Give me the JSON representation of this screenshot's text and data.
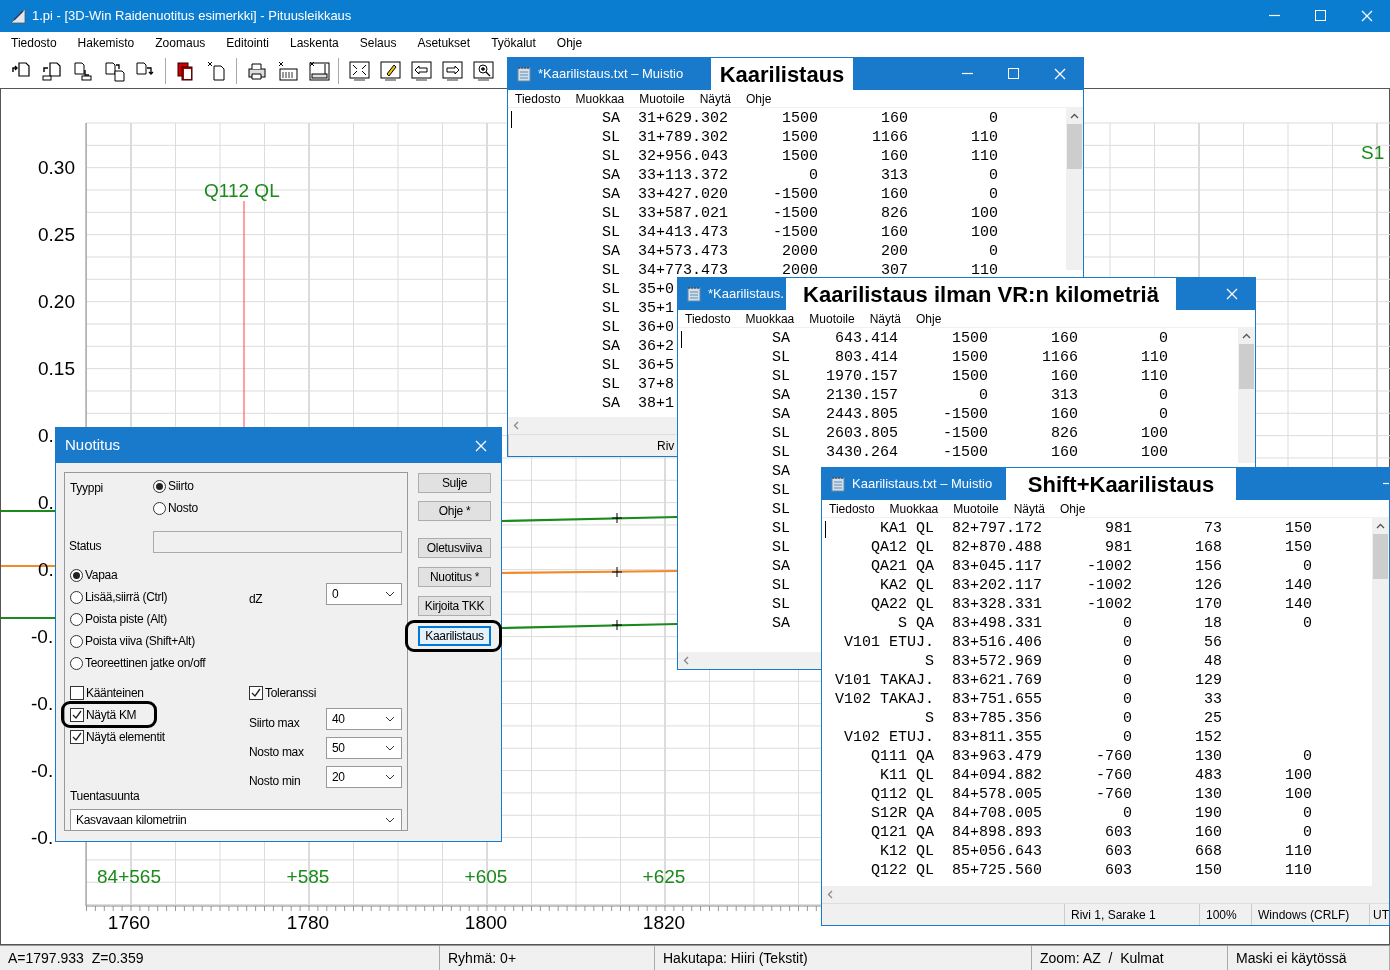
{
  "window": {
    "title": "1.pi - [3D-Win Raidenuotitus esimerkki] - Pituusleikkaus"
  },
  "menu": [
    "Tiedosto",
    "Hakemisto",
    "Zoomaus",
    "Editointi",
    "Laskenta",
    "Selaus",
    "Asetukset",
    "Työkalut",
    "Ohje"
  ],
  "profile": {
    "y_labels": [
      "0.30",
      "0.25",
      "0.20",
      "0.15",
      "0.",
      "0.",
      "0.",
      "-0.",
      "-0.",
      "-0.",
      "-0."
    ],
    "km_labels": [
      "84+565",
      "+585",
      "+605",
      "+625"
    ],
    "x_labels": [
      "1760",
      "1780",
      "1800",
      "1820"
    ],
    "marker_label": "Q112 QL",
    "edge_label": "S1"
  },
  "notepads": [
    {
      "title": "*Kaarilistaus.txt – Muistio",
      "caption": "Kaarilistaus",
      "menu": [
        "Tiedosto",
        "Muokkaa",
        "Muotoile",
        "Näytä",
        "Ohje"
      ],
      "rows": [
        [
          "SA",
          "31+629.302",
          "1500",
          "160",
          "0"
        ],
        [
          "SL",
          "31+789.302",
          "1500",
          "1166",
          "110"
        ],
        [
          "SL",
          "32+956.043",
          "1500",
          "160",
          "110"
        ],
        [
          "SA",
          "33+113.372",
          "0",
          "313",
          "0"
        ],
        [
          "SA",
          "33+427.020",
          "-1500",
          "160",
          "0"
        ],
        [
          "SL",
          "33+587.021",
          "-1500",
          "826",
          "100"
        ],
        [
          "SL",
          "34+413.473",
          "-1500",
          "160",
          "100"
        ],
        [
          "SA",
          "34+573.473",
          "2000",
          "200",
          "0"
        ],
        [
          "SL",
          "34+773.473",
          "2000",
          "307",
          "110"
        ],
        [
          "SL",
          "35+0"
        ],
        [
          "SL",
          "35+1"
        ],
        [
          "SL",
          "36+0"
        ],
        [
          "SA",
          "36+2"
        ],
        [
          "SL",
          "36+5"
        ],
        [
          "SL",
          "37+8"
        ],
        [
          "SA",
          "38+1"
        ]
      ],
      "status": [
        "Riv"
      ]
    },
    {
      "title": "*Kaarilistaus.",
      "caption": "Kaarilistaus ilman VR:n kilometriä",
      "menu": [
        "Tiedosto",
        "Muokkaa",
        "Muotoile",
        "Näytä",
        "Ohje"
      ],
      "rows": [
        [
          "SA",
          "643.414",
          "1500",
          "160",
          "0"
        ],
        [
          "SL",
          "803.414",
          "1500",
          "1166",
          "110"
        ],
        [
          "SL",
          "1970.157",
          "1500",
          "160",
          "110"
        ],
        [
          "SA",
          "2130.157",
          "0",
          "313",
          "0"
        ],
        [
          "SA",
          "2443.805",
          "-1500",
          "160",
          "0"
        ],
        [
          "SL",
          "2603.805",
          "-1500",
          "826",
          "100"
        ],
        [
          "SL",
          "3430.264",
          "-1500",
          "160",
          "100"
        ],
        [
          "SA"
        ],
        [
          "SL"
        ],
        [
          "SL"
        ],
        [
          "SL"
        ],
        [
          "SL"
        ],
        [
          "SA"
        ],
        [
          "SL"
        ],
        [
          "SL"
        ],
        [
          "SA"
        ]
      ]
    },
    {
      "title": "Kaarilistaus.txt – Muistio",
      "caption": "Shift+Kaarilistaus",
      "menu": [
        "Tiedosto",
        "Muokkaa",
        "Muotoile",
        "Näytä",
        "Ohje"
      ],
      "rows": [
        [
          "KA1 QL",
          "82+797.172",
          "981",
          "73",
          "150"
        ],
        [
          "QA12 QL",
          "82+870.488",
          "981",
          "168",
          "150"
        ],
        [
          "QA21 QA",
          "83+045.117",
          "-1002",
          "156",
          "0"
        ],
        [
          "KA2 QL",
          "83+202.117",
          "-1002",
          "126",
          "140"
        ],
        [
          "QA22 QL",
          "83+328.331",
          "-1002",
          "170",
          "140"
        ],
        [
          "S QA",
          "83+498.331",
          "0",
          "18",
          "0"
        ],
        [
          "V101 ETUJ.",
          "83+516.406",
          "0",
          "56"
        ],
        [
          "S",
          "83+572.969",
          "0",
          "48"
        ],
        [
          "V101 TAKAJ.",
          "83+621.769",
          "0",
          "129"
        ],
        [
          "V102 TAKAJ.",
          "83+751.655",
          "0",
          "33"
        ],
        [
          "S",
          "83+785.356",
          "0",
          "25"
        ],
        [
          "V102 ETUJ.",
          "83+811.355",
          "0",
          "152"
        ],
        [
          "Q111 QA",
          "83+963.479",
          "-760",
          "130",
          "0"
        ],
        [
          "K11 QL",
          "84+094.882",
          "-760",
          "483",
          "100"
        ],
        [
          "Q112 QL",
          "84+578.005",
          "-760",
          "130",
          "100"
        ],
        [
          "S12R QA",
          "84+708.005",
          "0",
          "190",
          "0"
        ],
        [
          "Q121 QA",
          "84+898.893",
          "603",
          "160",
          "0"
        ],
        [
          "K12 QL",
          "85+056.643",
          "603",
          "668",
          "110"
        ],
        [
          "Q122 QL",
          "85+725.560",
          "603",
          "150",
          "110"
        ]
      ],
      "status": [
        "Rivi 1, Sarake 1",
        "100%",
        "Windows (CRLF)",
        "UT"
      ]
    }
  ],
  "dialog": {
    "title": "Nuotitus",
    "type_label": "Tyyppi",
    "type_options": [
      {
        "label": "Siirto",
        "selected": true
      },
      {
        "label": "Nosto",
        "selected": false
      }
    ],
    "status_label": "Status",
    "modes": [
      {
        "label": "Vapaa",
        "selected": true
      },
      {
        "label": "Lisää,siirrä (Ctrl)",
        "selected": false
      },
      {
        "label": "Poista piste (Alt)",
        "selected": false
      },
      {
        "label": "Poista viiva (Shift+Alt)",
        "selected": false
      },
      {
        "label": "Teoreettinen jatke on/off",
        "selected": false
      }
    ],
    "dz": {
      "label": "dZ",
      "value": "0"
    },
    "checkboxes": [
      {
        "label": "Käänteinen",
        "checked": false,
        "highlighted": false
      },
      {
        "label": "Näytä KM",
        "checked": true,
        "highlighted": true
      },
      {
        "label": "Näytä elementit",
        "checked": true,
        "highlighted": false
      }
    ],
    "tolerance": {
      "label": "Toleranssi",
      "checked": true
    },
    "limits": [
      {
        "label": "Siirto max",
        "value": "40"
      },
      {
        "label": "Nosto max",
        "value": "50"
      },
      {
        "label": "Nosto min",
        "value": "20"
      }
    ],
    "support": {
      "label": "Tuentasuunta",
      "value": "Kasvavaan kilometriin"
    },
    "buttons": [
      {
        "label": "Sulje",
        "focused": false,
        "highlighted": false
      },
      {
        "label": "Ohje *",
        "focused": false,
        "highlighted": false
      },
      {
        "label": "Oletusviiva",
        "focused": false,
        "highlighted": false
      },
      {
        "label": "Nuotitus *",
        "focused": false,
        "highlighted": false
      },
      {
        "label": "Kirjoita TKK",
        "focused": false,
        "highlighted": false
      },
      {
        "label": "Kaarilistaus",
        "focused": true,
        "highlighted": true
      }
    ]
  },
  "status_bar": [
    "A=1797.933  Z=0.359",
    "Ryhmä: 0+",
    "Hakutapa: Hiiri (Tekstit)",
    "Zoom: AZ  /  Kulmat",
    "Maski ei käytössä"
  ]
}
